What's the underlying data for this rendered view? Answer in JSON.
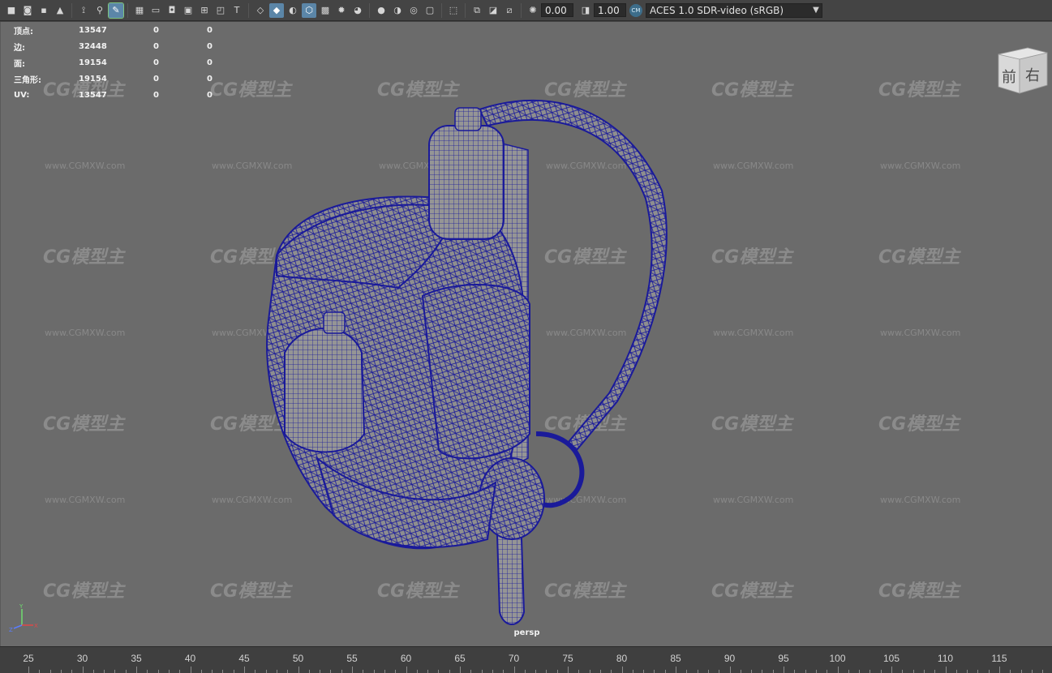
{
  "toolbar": {
    "exposure_value": "0.00",
    "gamma_value": "1.00",
    "color_space": "ACES 1.0 SDR-video (sRGB)",
    "icons": [
      "camera-icon",
      "camera-attributes-icon",
      "bookmark-icon",
      "image-plane-icon",
      "grid-icon",
      "film-gate-icon",
      "resolution-gate-icon",
      "gate-mask-icon",
      "field-chart-icon",
      "safe-action-icon",
      "safe-title-icon",
      "wireframe-icon",
      "smooth-shade-icon",
      "wireframe-on-shaded-icon",
      "textured-icon",
      "use-all-lights-icon",
      "shadows-icon",
      "screen-space-ao-icon",
      "motion-blur-icon",
      "multisample-aa-icon",
      "depth-of-field-icon",
      "isolate-select-icon",
      "xray-icon",
      "xray-joints-icon",
      "xray-active-icon",
      "backface-culling-icon",
      "exposure-icon",
      "gamma-icon",
      "color-management-icon"
    ]
  },
  "hud": {
    "rows": [
      {
        "label": "顶点:",
        "v1": "13547",
        "v2": "0",
        "v3": "0"
      },
      {
        "label": "边:",
        "v1": "32448",
        "v2": "0",
        "v3": "0"
      },
      {
        "label": "面:",
        "v1": "19154",
        "v2": "0",
        "v3": "0"
      },
      {
        "label": "三角形:",
        "v1": "19154",
        "v2": "0",
        "v3": "0"
      },
      {
        "label": "UV:",
        "v1": "13547",
        "v2": "0",
        "v3": "0"
      }
    ]
  },
  "viewcube": {
    "face_front": "前",
    "face_right": "右"
  },
  "camera_label": "persp",
  "watermark": {
    "logo": "CG模型主",
    "url": "www.CGMXW.com"
  },
  "timeline": {
    "ticks": [
      "25",
      "30",
      "35",
      "40",
      "45",
      "50",
      "55",
      "60",
      "65",
      "70",
      "75",
      "80",
      "85",
      "90",
      "95",
      "100",
      "105",
      "110",
      "115"
    ]
  },
  "colors": {
    "wireframe": "#1a1a9a",
    "viewport_bg": "#6b6b6b",
    "mesh_fill": "#8c8c8c"
  }
}
